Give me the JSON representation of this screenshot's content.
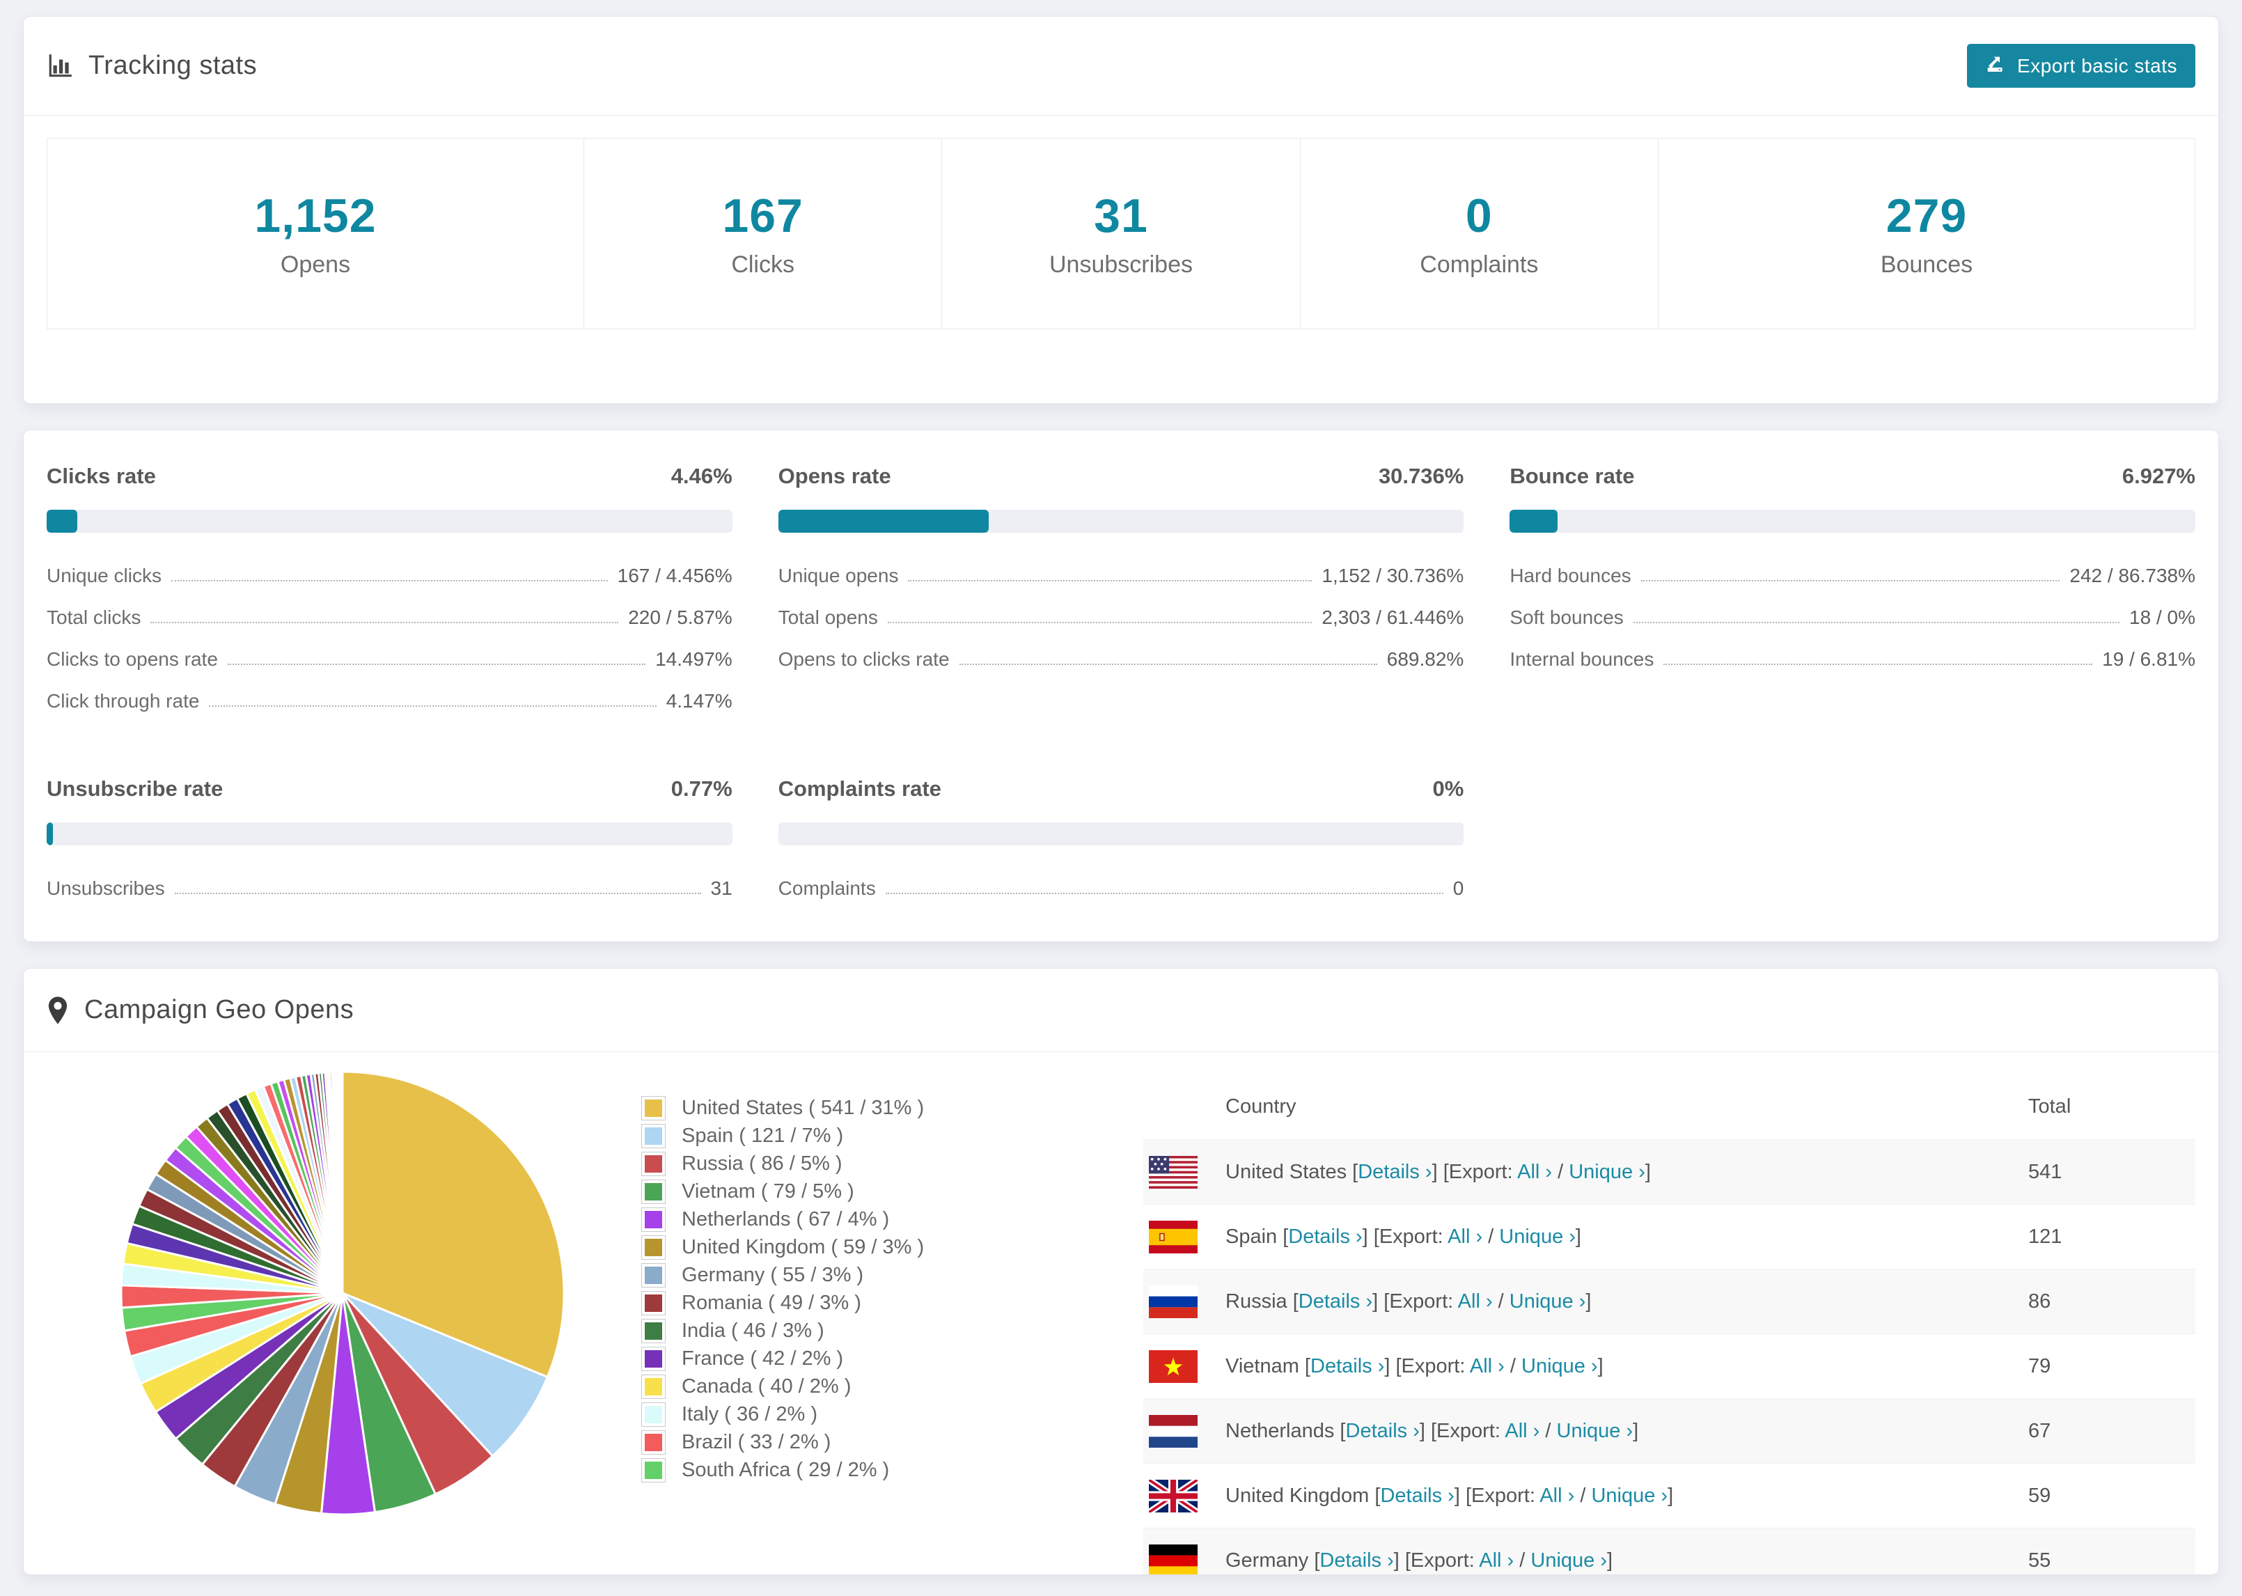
{
  "colors": {
    "accent": "#0f87a0",
    "track": "#edeff4",
    "page_bg": "#f0f1f5"
  },
  "tracking": {
    "title": "Tracking stats",
    "export_button": "Export basic stats",
    "stats": [
      {
        "value": "1,152",
        "label": "Opens"
      },
      {
        "value": "167",
        "label": "Clicks"
      },
      {
        "value": "31",
        "label": "Unsubscribes"
      },
      {
        "value": "0",
        "label": "Complaints"
      },
      {
        "value": "279",
        "label": "Bounces"
      }
    ]
  },
  "rates": [
    {
      "title": "Clicks rate",
      "value": "4.46%",
      "percent": 4.46,
      "rows": [
        {
          "label": "Unique clicks",
          "value": "167 / 4.456%"
        },
        {
          "label": "Total clicks",
          "value": "220 / 5.87%"
        },
        {
          "label": "Clicks to opens rate",
          "value": "14.497%"
        },
        {
          "label": "Click through rate",
          "value": "4.147%"
        }
      ]
    },
    {
      "title": "Opens rate",
      "value": "30.736%",
      "percent": 30.736,
      "rows": [
        {
          "label": "Unique opens",
          "value": "1,152 / 30.736%"
        },
        {
          "label": "Total opens",
          "value": "2,303 / 61.446%"
        },
        {
          "label": "Opens to clicks rate",
          "value": "689.82%"
        }
      ]
    },
    {
      "title": "Bounce rate",
      "value": "6.927%",
      "percent": 6.927,
      "rows": [
        {
          "label": "Hard bounces",
          "value": "242 / 86.738%"
        },
        {
          "label": "Soft bounces",
          "value": "18 / 0%"
        },
        {
          "label": "Internal bounces",
          "value": "19 / 6.81%"
        }
      ]
    },
    {
      "title": "Unsubscribe rate",
      "value": "0.77%",
      "percent": 0.77,
      "rows": [
        {
          "label": "Unsubscribes",
          "value": "31"
        }
      ]
    },
    {
      "title": "Complaints rate",
      "value": "0%",
      "percent": 0,
      "rows": [
        {
          "label": "Complaints",
          "value": "0"
        }
      ]
    }
  ],
  "geo": {
    "title": "Campaign Geo Opens",
    "chart_data": {
      "type": "pie",
      "title": "Campaign Geo Opens",
      "legend_position": "right",
      "series": [
        {
          "name": "United States",
          "value": 541,
          "percent": 31,
          "color": "#e7c04a"
        },
        {
          "name": "Spain",
          "value": 121,
          "percent": 7,
          "color": "#aed5f2"
        },
        {
          "name": "Russia",
          "value": 86,
          "percent": 5,
          "color": "#c94d4f"
        },
        {
          "name": "Vietnam",
          "value": 79,
          "percent": 5,
          "color": "#4ba556"
        },
        {
          "name": "Netherlands",
          "value": 67,
          "percent": 4,
          "color": "#a640ea"
        },
        {
          "name": "United Kingdom",
          "value": 59,
          "percent": 3,
          "color": "#b6952c"
        },
        {
          "name": "Germany",
          "value": 55,
          "percent": 3,
          "color": "#8aabca"
        },
        {
          "name": "Romania",
          "value": 49,
          "percent": 3,
          "color": "#9e3a3c"
        },
        {
          "name": "India",
          "value": 46,
          "percent": 3,
          "color": "#3e7d44"
        },
        {
          "name": "France",
          "value": 42,
          "percent": 2,
          "color": "#7631b8"
        },
        {
          "name": "Canada",
          "value": 40,
          "percent": 2,
          "color": "#f8e04b"
        },
        {
          "name": "Italy",
          "value": 36,
          "percent": 2,
          "color": "#d9fbfb"
        },
        {
          "name": "Brazil",
          "value": 33,
          "percent": 2,
          "color": "#f25c5c"
        },
        {
          "name": "South Africa",
          "value": 29,
          "percent": 2,
          "color": "#63d068"
        }
      ],
      "others": {
        "values": [
          28,
          27,
          26,
          25,
          24,
          23,
          22,
          21,
          20,
          19,
          18,
          17,
          16,
          15,
          14,
          13,
          12,
          11,
          10,
          9,
          8,
          8,
          7,
          7,
          6,
          6,
          5,
          5,
          4,
          4,
          3,
          3,
          3,
          2,
          2,
          2,
          2,
          1,
          1,
          1,
          1,
          1
        ],
        "colors": [
          "#f25c5c",
          "#d9fbfb",
          "#f6ef4e",
          "#5e35b1",
          "#2f6d31",
          "#8e3436",
          "#7f9ab8",
          "#a08023",
          "#b14cf0",
          "#66d068",
          "#e04ef5",
          "#8a7a1e",
          "#27502b",
          "#7a2e30",
          "#283593",
          "#1b4d20",
          "#f4f44e",
          "#eef6ff",
          "#fa6b6b",
          "#57c45c",
          "#c74ef0",
          "#b6952c",
          "#aed5f2",
          "#c94d4f",
          "#4ba556",
          "#a640ea",
          "#8aabca",
          "#9e3a3c",
          "#3e7d44",
          "#7631b8",
          "#f8e04b",
          "#d9fbfb",
          "#f25c5c",
          "#63d068",
          "#e7c04a",
          "#aed5f2",
          "#c94d4f",
          "#4ba556",
          "#a640ea",
          "#b6952c",
          "#8aabca",
          "#9e3a3c"
        ]
      }
    },
    "table": {
      "country_header": "Country",
      "total_header": "Total",
      "link_details": "Details ›",
      "export_prefix": "Export:",
      "link_all": "All ›",
      "link_unique": "Unique ›",
      "rows": [
        {
          "country": "United States",
          "total": "541",
          "flag": "us"
        },
        {
          "country": "Spain",
          "total": "121",
          "flag": "es"
        },
        {
          "country": "Russia",
          "total": "86",
          "flag": "ru"
        },
        {
          "country": "Vietnam",
          "total": "79",
          "flag": "vn"
        },
        {
          "country": "Netherlands",
          "total": "67",
          "flag": "nl"
        },
        {
          "country": "United Kingdom",
          "total": "59",
          "flag": "gb"
        },
        {
          "country": "Germany",
          "total": "55",
          "flag": "de"
        }
      ]
    }
  }
}
